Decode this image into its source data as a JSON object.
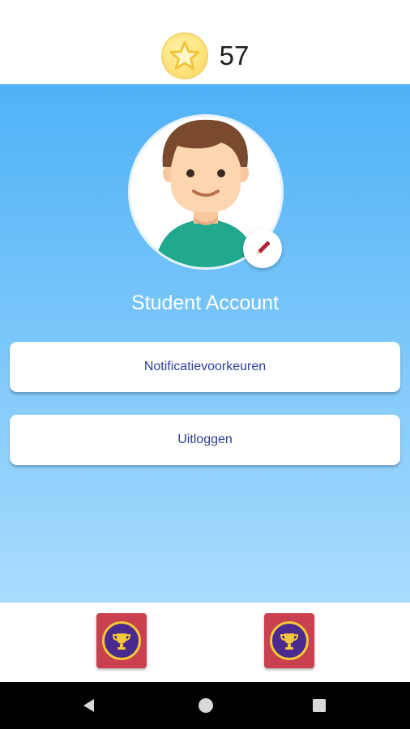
{
  "header": {
    "points": "57",
    "icon": "star-coin-icon"
  },
  "profile": {
    "title": "Student Account",
    "avatar_icon": "boy-avatar-icon",
    "edit_icon": "pencil-icon"
  },
  "menu": {
    "notification_label": "Notificatievoorkeuren",
    "logout_label": "Uitloggen"
  },
  "tabs": [
    {
      "icon": "trophy-icon"
    },
    {
      "icon": "trophy-icon"
    }
  ],
  "nav": {
    "back_icon": "back-triangle-icon",
    "home_icon": "home-circle-icon",
    "recent_icon": "recent-square-icon"
  },
  "colors": {
    "gradient_top": "#4fb2f6",
    "gradient_bottom": "#a9dcfd",
    "button_text": "#2c3e9a",
    "tab_bg": "#c9404e",
    "trophy_ring": "#f3c63b",
    "trophy_inner": "#4a2a8e"
  }
}
